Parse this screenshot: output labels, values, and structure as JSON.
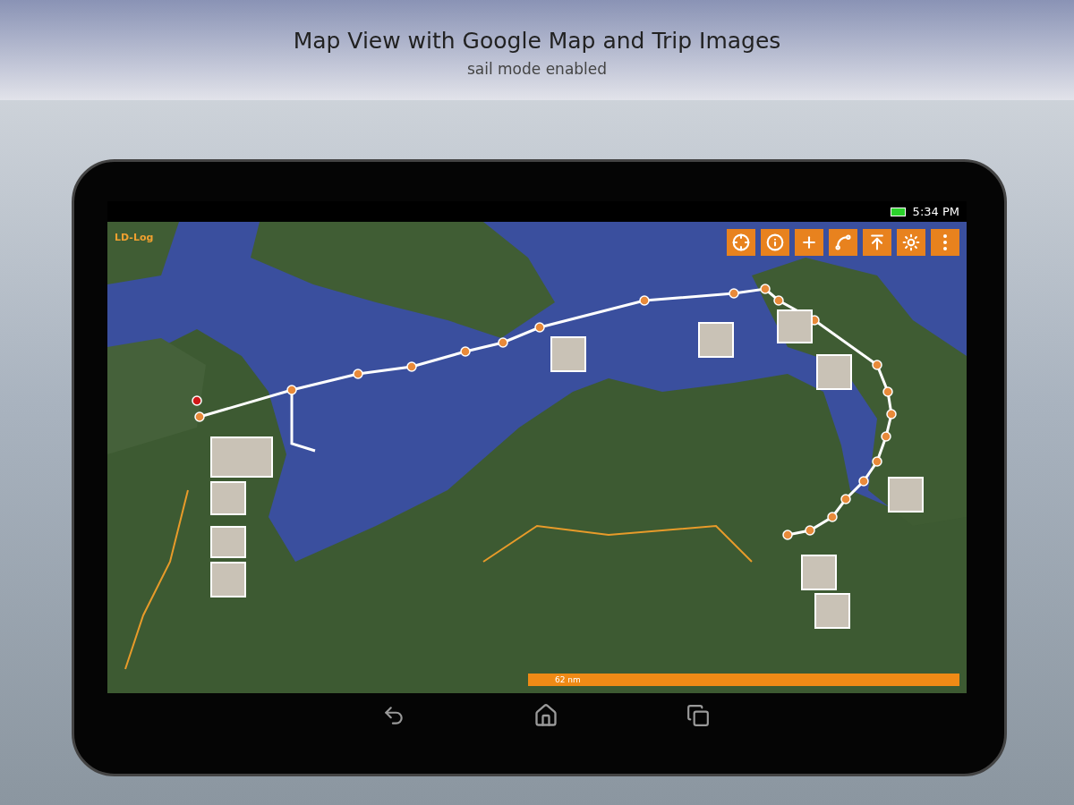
{
  "header": {
    "title": "Map View with Google Map and Trip Images",
    "subtitle": "sail mode enabled"
  },
  "status_bar": {
    "time": "5:34 PM"
  },
  "map": {
    "app_label": "LD-Log",
    "scale": "62 nm"
  }
}
